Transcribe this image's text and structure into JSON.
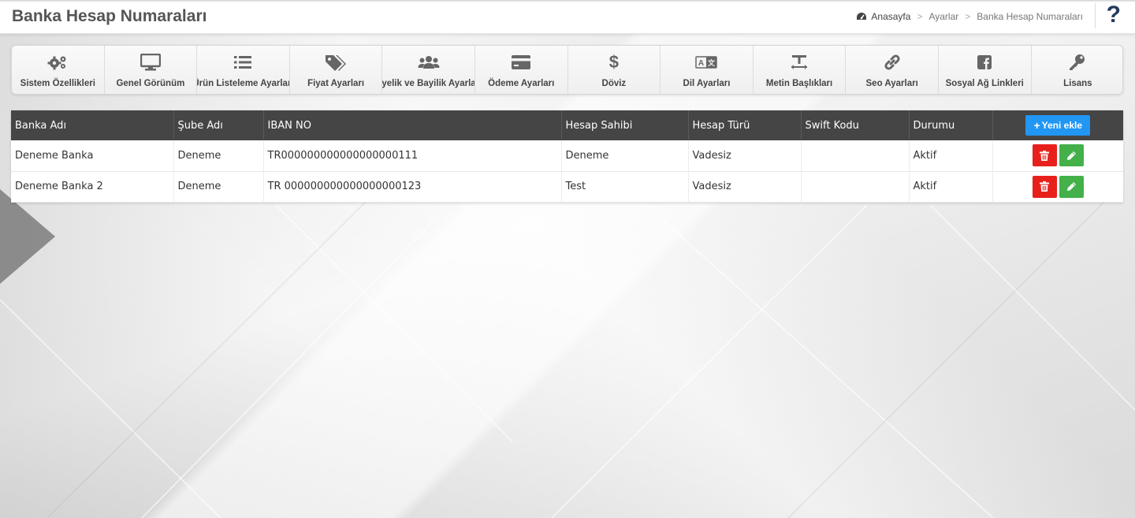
{
  "header": {
    "title": "Banka Hesap Numaraları",
    "breadcrumb": [
      "Anasayfa",
      "Ayarlar",
      "Banka Hesap Numaraları"
    ],
    "help": "?"
  },
  "menu": [
    {
      "label": "Sistem Özellikleri",
      "icon": "gears-icon"
    },
    {
      "label": "Genel Görünüm",
      "icon": "monitor-icon"
    },
    {
      "label": "Ürün Listeleme Ayarları",
      "icon": "list-icon"
    },
    {
      "label": "Fiyat Ayarları",
      "icon": "tags-icon"
    },
    {
      "label": "Üyelik ve Bayilik Ayarları",
      "icon": "users-icon"
    },
    {
      "label": "Ödeme Ayarları",
      "icon": "credit-card-icon"
    },
    {
      "label": "Döviz",
      "icon": "dollar-icon"
    },
    {
      "label": "Dil Ayarları",
      "icon": "language-icon"
    },
    {
      "label": "Metin Başlıkları",
      "icon": "text-height-icon"
    },
    {
      "label": "Seo Ayarları",
      "icon": "link-icon"
    },
    {
      "label": "Sosyal Ağ Linkleri",
      "icon": "facebook-icon"
    },
    {
      "label": "Lisans",
      "icon": "key-icon"
    }
  ],
  "table": {
    "columns": [
      "Banka Adı",
      "Şube Adı",
      "IBAN NO",
      "Hesap Sahibi",
      "Hesap Türü",
      "Swift Kodu",
      "Durumu"
    ],
    "add_label": "Yeni ekle",
    "rows": [
      {
        "banka": "Deneme Banka",
        "sube": "Deneme",
        "iban": "TR000000000000000000111",
        "sahip": "Deneme",
        "tur": "Vadesiz",
        "swift": "",
        "durum": "Aktif"
      },
      {
        "banka": "Deneme Banka 2",
        "sube": "Deneme",
        "iban": "TR 000000000000000000123",
        "sahip": "Test",
        "tur": "Vadesiz",
        "swift": "",
        "durum": "Aktif"
      }
    ]
  },
  "colors": {
    "header_bg": "#454545",
    "add_button": "#2196f3",
    "delete_button": "#e8201c",
    "edit_button": "#43b049"
  }
}
